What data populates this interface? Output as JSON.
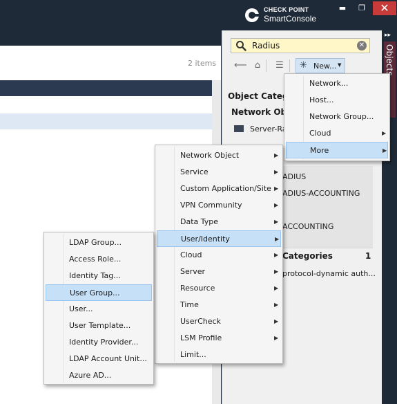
{
  "app": {
    "brand_top": "CHECK POINT",
    "brand_bottom": "SmartConsole",
    "minimize": "▬",
    "restore": "❐",
    "close": "✕"
  },
  "main": {
    "items_count": "2 items"
  },
  "objects_panel": {
    "side_tab_label": "Objects",
    "search": {
      "value": "Radius",
      "placeholder": ""
    },
    "toolbar": {
      "new_label": "New..."
    },
    "object_categories_label": "Object Categor",
    "network_objects_label": "Network Obje",
    "server_item": "Server-Ra",
    "results": [
      "ADIUS",
      "ADIUS-ACCOUNTING",
      "ACCOUNTING"
    ],
    "categories_label": "Categories",
    "categories_count": "1",
    "category_item": "protocol-dynamic auth..."
  },
  "menus": {
    "new_menu": [
      {
        "label": "Network...",
        "submenu": false,
        "highlighted": false
      },
      {
        "label": "Host...",
        "submenu": false,
        "highlighted": false
      },
      {
        "label": "Network Group...",
        "submenu": false,
        "highlighted": false
      },
      {
        "label": "Cloud",
        "submenu": true,
        "highlighted": false
      },
      {
        "label": "More",
        "submenu": true,
        "highlighted": true
      }
    ],
    "more_menu": [
      {
        "label": "Network Object",
        "submenu": true,
        "highlighted": false
      },
      {
        "label": "Service",
        "submenu": true,
        "highlighted": false
      },
      {
        "label": "Custom Application/Site",
        "submenu": true,
        "highlighted": false
      },
      {
        "label": "VPN Community",
        "submenu": true,
        "highlighted": false
      },
      {
        "label": "Data Type",
        "submenu": true,
        "highlighted": false
      },
      {
        "label": "User/Identity",
        "submenu": true,
        "highlighted": true
      },
      {
        "label": "Cloud",
        "submenu": true,
        "highlighted": false
      },
      {
        "label": "Server",
        "submenu": true,
        "highlighted": false
      },
      {
        "label": "Resource",
        "submenu": true,
        "highlighted": false
      },
      {
        "label": "Time",
        "submenu": true,
        "highlighted": false
      },
      {
        "label": "UserCheck",
        "submenu": true,
        "highlighted": false
      },
      {
        "label": "LSM Profile",
        "submenu": true,
        "highlighted": false
      },
      {
        "label": "Limit...",
        "submenu": false,
        "highlighted": false
      }
    ],
    "user_identity_menu": [
      {
        "label": "LDAP Group...",
        "highlighted": false
      },
      {
        "label": "Access Role...",
        "highlighted": false
      },
      {
        "label": "Identity Tag...",
        "highlighted": false
      },
      {
        "label": "User Group...",
        "highlighted": true
      },
      {
        "label": "User...",
        "highlighted": false
      },
      {
        "label": "User Template...",
        "highlighted": false
      },
      {
        "label": "Identity Provider...",
        "highlighted": false
      },
      {
        "label": "LDAP Account Unit...",
        "highlighted": false
      },
      {
        "label": "Azure AD...",
        "highlighted": false
      }
    ]
  },
  "colors": {
    "titlebar": "#1f2a38",
    "highlight": "#c5e0f7",
    "search_bg": "#fff7c7",
    "close_button": "#c73b3b"
  }
}
